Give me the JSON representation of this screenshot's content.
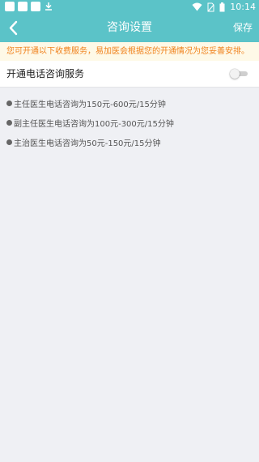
{
  "status_bar": {
    "icons": [
      "square-icon",
      "square-icon",
      "square-icon",
      "download-icon",
      "wifi-icon",
      "no-sim-icon",
      "battery-icon"
    ],
    "time": "10:14"
  },
  "header": {
    "back_icon": "chevron-left-icon",
    "title": "咨询设置",
    "save_label": "保存",
    "background": "#5bc3c8"
  },
  "notice": {
    "text": "您可开通以下收费服务，易加医会根据您的开通情况为您妥善安排。",
    "color": "#f0811b",
    "background": "#fef9e7"
  },
  "phone_service": {
    "label": "开通电话咨询服务",
    "enabled": false
  },
  "price_list": [
    "主任医生电话咨询为150元-600元/15分钟",
    "副主任医生电话咨询为100元-300元/15分钟",
    "主治医生电话咨询为50元-150元/15分钟"
  ]
}
